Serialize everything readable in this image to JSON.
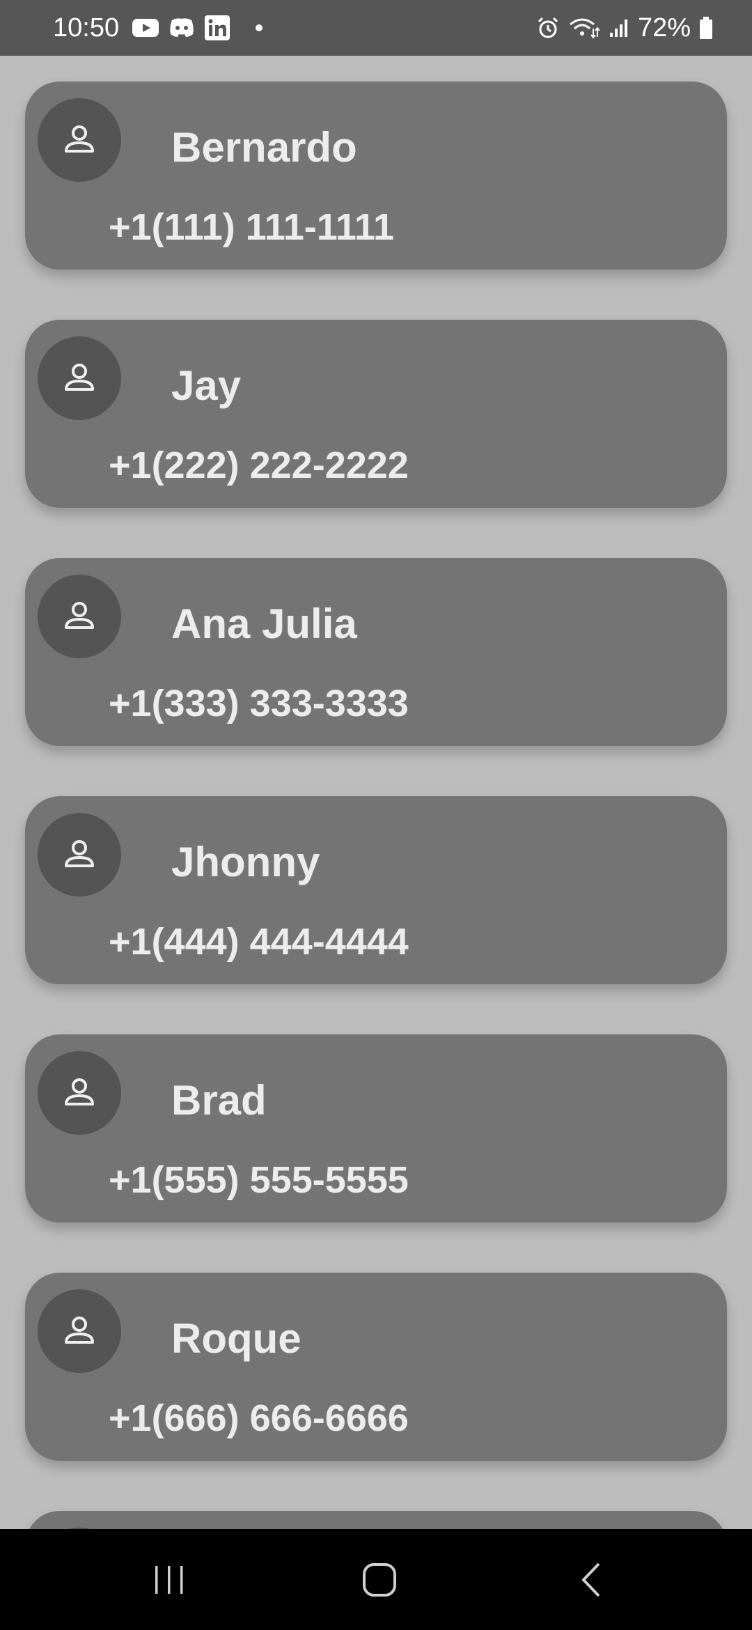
{
  "status_bar": {
    "time": "10:50",
    "battery_percent": "72%",
    "notification_icons": [
      "youtube-icon",
      "discord-icon",
      "linkedin-icon"
    ],
    "system_icons": [
      "alarm-icon",
      "wifi-icon",
      "signal-icon",
      "battery-icon"
    ]
  },
  "contacts": [
    {
      "name": "Bernardo",
      "phone": "+1(111) 111-1111"
    },
    {
      "name": "Jay",
      "phone": "+1(222) 222-2222"
    },
    {
      "name": "Ana Julia",
      "phone": "+1(333) 333-3333"
    },
    {
      "name": "Jhonny",
      "phone": "+1(444) 444-4444"
    },
    {
      "name": "Brad",
      "phone": "+1(555) 555-5555"
    },
    {
      "name": "Roque",
      "phone": "+1(666) 666-6666"
    }
  ],
  "nav_bar": {
    "buttons": [
      "recent-apps-icon",
      "home-icon",
      "back-icon"
    ]
  },
  "colors": {
    "background": "#bdbdbd",
    "card": "#747474",
    "avatar": "#545454",
    "text": "#ececec",
    "status_bar": "#565656",
    "nav_bar": "#000000"
  }
}
